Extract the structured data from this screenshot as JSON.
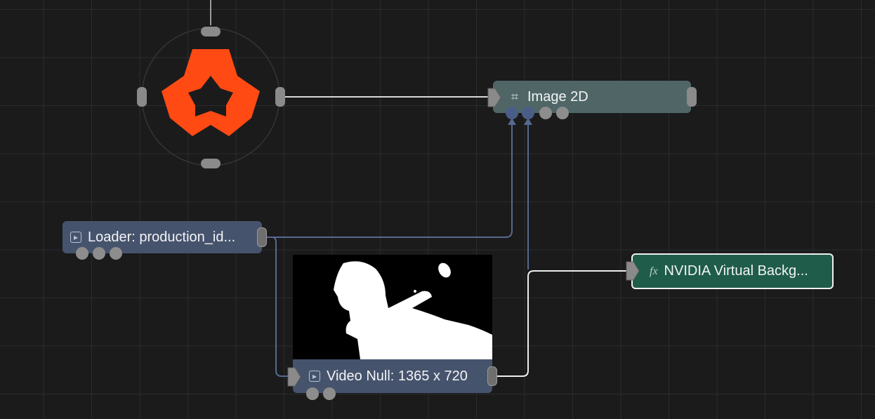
{
  "graph": {
    "nodes": {
      "image2d": {
        "label": "Image 2D",
        "icon": "crop-grid-icon"
      },
      "loader": {
        "label": "Loader: production_id...",
        "icon": "play-box-icon"
      },
      "video_null": {
        "label": "Video Null: 1365 x 720",
        "icon": "play-box-icon"
      },
      "nvidia": {
        "label": "NVIDIA Virtual Backg...",
        "icon": "fx-icon"
      },
      "logo_node": {
        "icon": "orange-flower-logo-icon"
      }
    },
    "icons": {
      "crop": "⌗",
      "play": "▸",
      "fx": "fx"
    },
    "colors": {
      "background": "#1b1b1c",
      "image2d_node": "#506666",
      "loader_node": "#46536c",
      "nvidia_node": "#1f5c4a",
      "logo_orange": "#ff4a14",
      "wire_white": "#e8e8e8",
      "wire_blue": "#56698f"
    }
  }
}
